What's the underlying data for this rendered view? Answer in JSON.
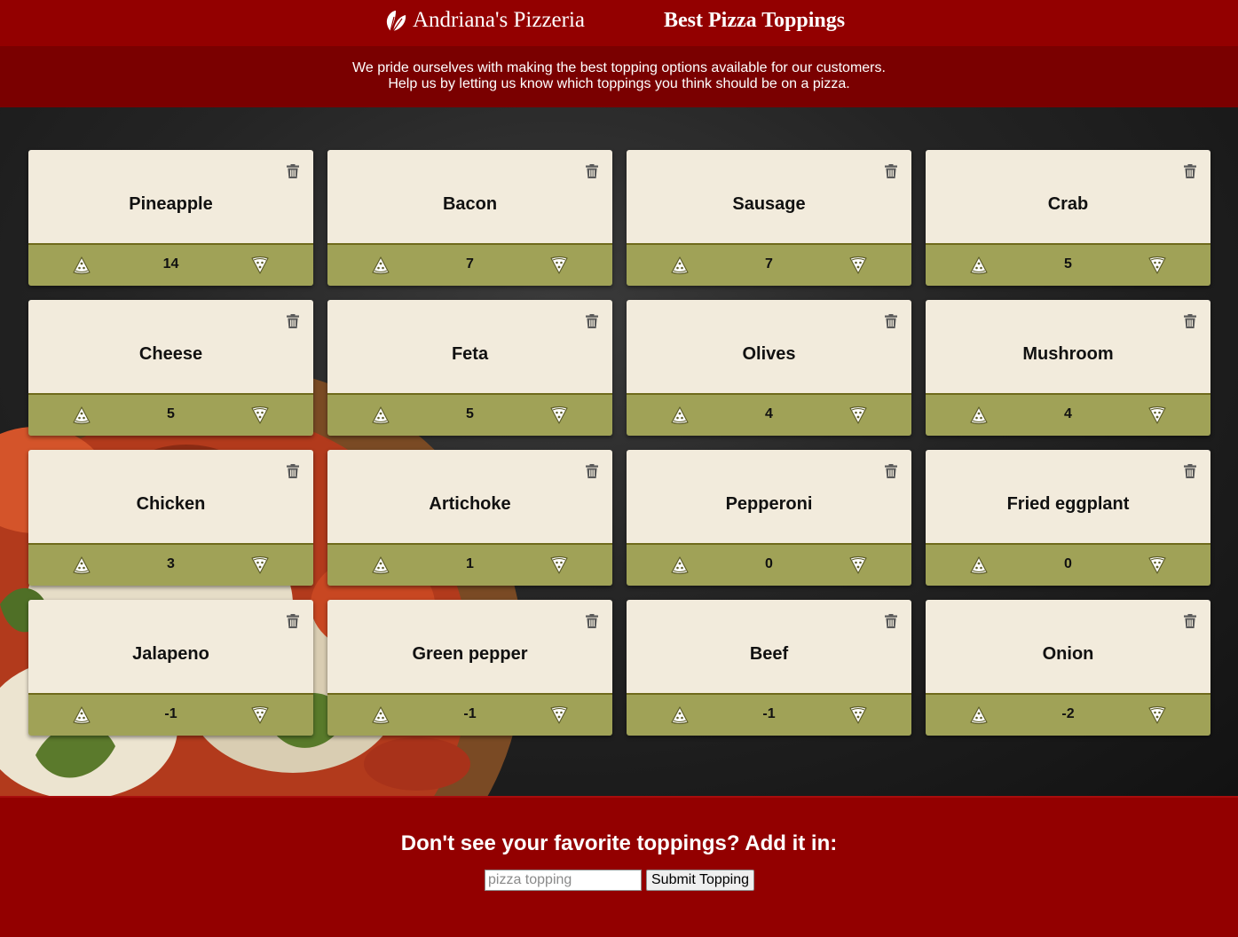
{
  "header": {
    "brand_name": "Andriana's Pizzeria",
    "title": "Best Pizza Toppings",
    "logo_icon": "leaf-logo-icon"
  },
  "intro": {
    "line1": "We pride ourselves with making the best topping options available for our customers.",
    "line2": "Help us by letting us know which toppings you think should be on a pizza."
  },
  "colors": {
    "header_red": "#930000",
    "intro_red": "#7a0000",
    "card_bg": "#f2ebdc",
    "card_footer": "#a0a257"
  },
  "icons": {
    "delete": "trash-icon",
    "downvote": "pizza-slice-down-icon",
    "upvote": "pizza-slice-up-icon"
  },
  "toppings": [
    {
      "name": "Pineapple",
      "votes": "14"
    },
    {
      "name": "Bacon",
      "votes": "7"
    },
    {
      "name": "Sausage",
      "votes": "7"
    },
    {
      "name": "Crab",
      "votes": "5"
    },
    {
      "name": "Cheese",
      "votes": "5"
    },
    {
      "name": "Feta",
      "votes": "5"
    },
    {
      "name": "Olives",
      "votes": "4"
    },
    {
      "name": "Mushroom",
      "votes": "4"
    },
    {
      "name": "Chicken",
      "votes": "3"
    },
    {
      "name": "Artichoke",
      "votes": "1"
    },
    {
      "name": "Pepperoni",
      "votes": "0"
    },
    {
      "name": "Fried eggplant",
      "votes": "0"
    },
    {
      "name": "Jalapeno",
      "votes": "-1"
    },
    {
      "name": "Green pepper",
      "votes": "-1"
    },
    {
      "name": "Beef",
      "votes": "-1"
    },
    {
      "name": "Onion",
      "votes": "-2"
    }
  ],
  "add_form": {
    "heading": "Don't see your favorite toppings? Add it in:",
    "input_placeholder": "pizza topping",
    "input_value": "",
    "submit_label": "Submit Topping"
  }
}
